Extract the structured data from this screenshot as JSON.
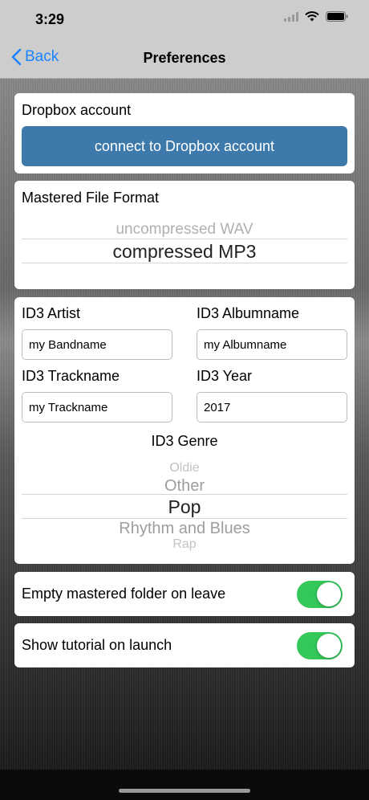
{
  "status": {
    "time": "3:29"
  },
  "nav": {
    "back_label": "Back",
    "title": "Preferences"
  },
  "dropbox": {
    "label": "Dropbox account",
    "button_label": "connect to Dropbox account"
  },
  "format": {
    "label": "Mastered File Format",
    "options": [
      "uncompressed WAV",
      "compressed MP3"
    ],
    "selected": "compressed MP3"
  },
  "id3": {
    "artist_label": "ID3 Artist",
    "artist_value": "my Bandname",
    "album_label": "ID3 Albumname",
    "album_value": "my Albumname",
    "track_label": "ID3 Trackname",
    "track_value": "my Trackname",
    "year_label": "ID3 Year",
    "year_value": "2017",
    "genre_label": "ID3 Genre",
    "genre_options": [
      "Oldie",
      "Other",
      "Pop",
      "Rhythm and Blues",
      "Rap"
    ],
    "genre_selected": "Pop"
  },
  "settings": {
    "empty_folder_label": "Empty mastered folder on leave",
    "empty_folder_on": true,
    "tutorial_label": "Show tutorial on launch",
    "tutorial_on": true
  },
  "colors": {
    "accent": "#1a84ff",
    "button": "#3d79aa",
    "toggle_on": "#34c759"
  }
}
